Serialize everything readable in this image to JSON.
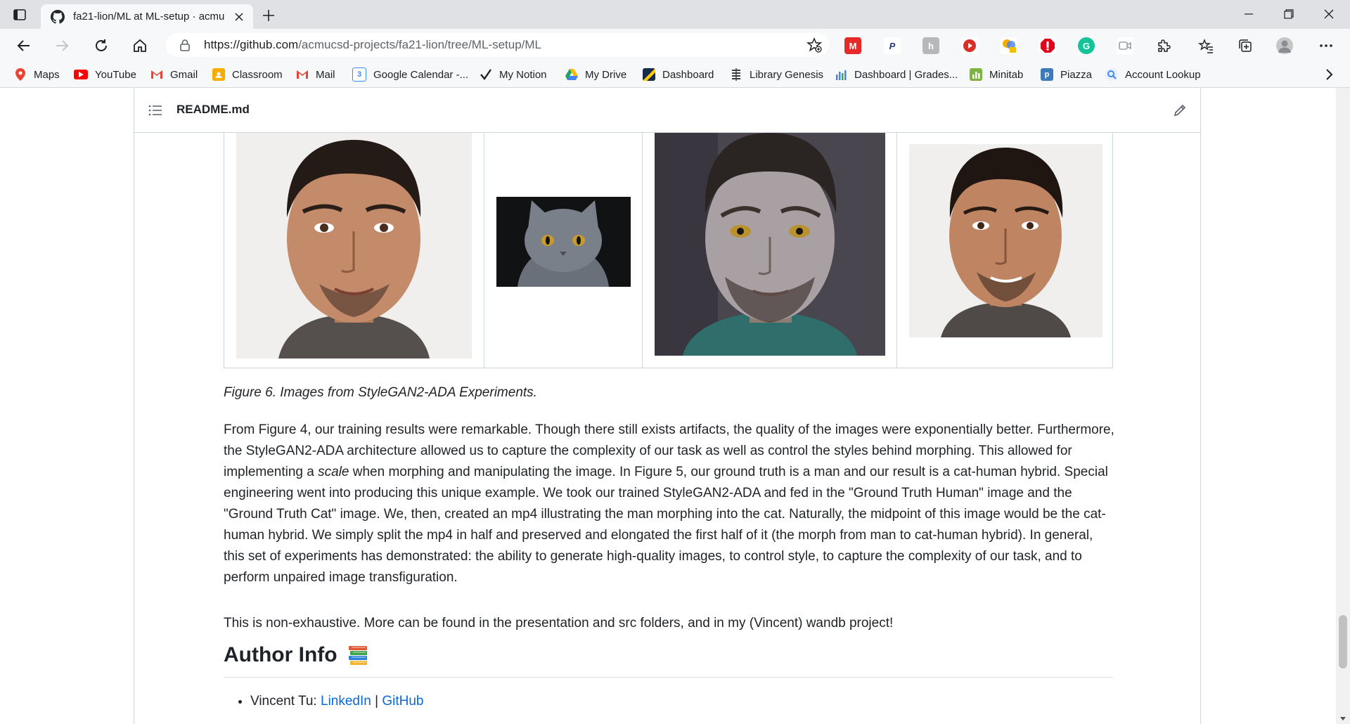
{
  "browser": {
    "tab_title": "fa21-lion/ML at ML-setup · acmu",
    "url_host": "https://github.com",
    "url_path": "/acmucsd-projects/fa21-lion/tree/ML-setup/ML"
  },
  "bookmarks": [
    {
      "label": "Maps",
      "icon": "maps-pin-icon",
      "color": "#ea4335"
    },
    {
      "label": "YouTube",
      "icon": "youtube-icon",
      "color": "#ff0000"
    },
    {
      "label": "Gmail",
      "icon": "gmail-icon",
      "color": "#ea4335"
    },
    {
      "label": "Classroom",
      "icon": "classroom-icon",
      "color": "#f9ab00"
    },
    {
      "label": "Mail",
      "icon": "mail-icon",
      "color": "#ea4335"
    },
    {
      "label": "Google Calendar -...",
      "icon": "calendar-icon",
      "color": "#4285f4"
    },
    {
      "label": "My Notion",
      "icon": "checkmark-icon",
      "color": "#202124"
    },
    {
      "label": "My Drive",
      "icon": "drive-icon",
      "color": "#1fa463"
    },
    {
      "label": "Dashboard",
      "icon": "dashboard-icon",
      "color": "#182b49"
    },
    {
      "label": "Library Genesis",
      "icon": "library-icon",
      "color": "#3c4043"
    },
    {
      "label": "Dashboard | Grades...",
      "icon": "bar-chart-icon",
      "color": "#4285f4"
    },
    {
      "label": "Minitab",
      "icon": "minitab-icon",
      "color": "#7cb342"
    },
    {
      "label": "Piazza",
      "icon": "piazza-icon",
      "color": "#3e7ab8"
    },
    {
      "label": "Account Lookup",
      "icon": "account-lookup-icon",
      "color": "#4285f4"
    }
  ],
  "readme": {
    "filename": "README.md",
    "figure_caption": "Figure 6. Images from StyleGAN2-ADA Experiments.",
    "para1_a": "From Figure 4, our training results were remarkable. Though there still exists artifacts, the quality of the images were exponentially better. Furthermore, the StyleGAN2-ADA architecture allowed us to capture the complexity of our task as well as control the styles behind morphing. This allowed for implementing a ",
    "para1_em": "scale",
    "para1_b": " when morphing and manipulating the image. In Figure 5, our ground truth is a man and our result is a cat-human hybrid. Special engineering went into producing this unique example. We took our trained StyleGAN2-ADA and fed in the \"Ground Truth Human\" image and the \"Ground Truth Cat\" image. We, then, created an mp4 illustrating the man morphing into the cat. Naturally, the midpoint of this image would be the cat-human hybrid. We simply split the mp4 in half and preserved and elongated the first half of it (the morph from man to cat-human hybrid). In general, this set of experiments has demonstrated: the ability to generate high-quality images, to control style, to capture the complexity of our task, and to perform unpaired image transfiguration.",
    "para2": "This is non-exhaustive. More can be found in the presentation and src folders, and in my (Vincent) wandb project!",
    "heading": "Author Info",
    "heading_icon": "books-icon",
    "authors": [
      {
        "name": "Vincent Tu: ",
        "link1": "LinkedIn",
        "sep": " | ",
        "link2": "GitHub"
      }
    ]
  },
  "colors": {
    "link": "#0969da",
    "accent": "#0969da"
  }
}
